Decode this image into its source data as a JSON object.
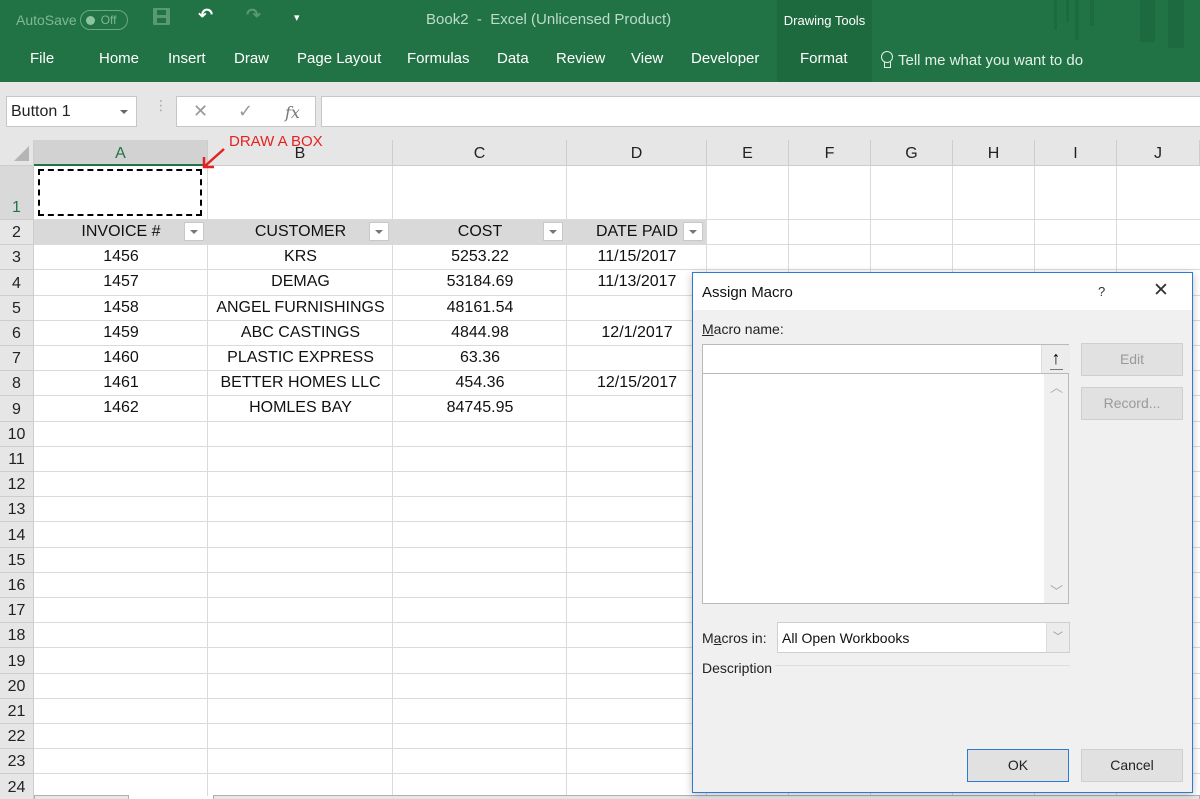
{
  "titlebar": {
    "autosave_label": "AutoSave",
    "autosave_state": "Off",
    "document_title": "Book2  -  Excel (Unlicensed Product)",
    "contextual_group": "Drawing Tools",
    "icons": [
      "save-icon",
      "undo-icon",
      "redo-icon",
      "customize-qat-icon"
    ]
  },
  "ribbon": {
    "tabs": [
      {
        "label": "File"
      },
      {
        "label": "Home"
      },
      {
        "label": "Insert"
      },
      {
        "label": "Draw"
      },
      {
        "label": "Page Layout"
      },
      {
        "label": "Formulas"
      },
      {
        "label": "Data"
      },
      {
        "label": "Review"
      },
      {
        "label": "View"
      },
      {
        "label": "Developer"
      },
      {
        "label": "Format"
      }
    ],
    "tell_me": "Tell me what you want to do"
  },
  "formula_bar": {
    "name_box": "Button 1",
    "cancel_glyph": "✕",
    "enter_glyph": "✓",
    "fx_glyph": "fx",
    "formula": ""
  },
  "sheet": {
    "columns": [
      "A",
      "B",
      "C",
      "D",
      "E",
      "F",
      "G",
      "H",
      "I",
      "J"
    ],
    "selected_column": "A",
    "rows": [
      "1",
      "2",
      "3",
      "4",
      "5",
      "6",
      "7",
      "8",
      "9",
      "10",
      "11",
      "12",
      "13",
      "14",
      "15",
      "16",
      "17",
      "18",
      "19",
      "20",
      "21",
      "22",
      "23",
      "24"
    ],
    "selected_row": "1",
    "annotation": "DRAW A BOX",
    "table_headers": [
      "INVOICE #",
      "CUSTOMER",
      "COST",
      "DATE PAID"
    ],
    "table_rows": [
      [
        "1456",
        "KRS",
        "5253.22",
        "11/15/2017"
      ],
      [
        "1457",
        "DEMAG",
        "53184.69",
        "11/13/2017"
      ],
      [
        "1458",
        "ANGEL FURNISHINGS",
        "48161.54",
        ""
      ],
      [
        "1459",
        "ABC CASTINGS",
        "4844.98",
        "12/1/2017"
      ],
      [
        "1460",
        "PLASTIC EXPRESS",
        "63.36",
        ""
      ],
      [
        "1461",
        "BETTER HOMES LLC",
        "454.36",
        "12/15/2017"
      ],
      [
        "1462",
        "HOMLES BAY",
        "84745.95",
        ""
      ]
    ]
  },
  "dialog": {
    "title": "Assign Macro",
    "help_glyph": "?",
    "close_glyph": "✕",
    "macro_name_label_u": "M",
    "macro_name_label_rest": "acro name:",
    "macro_name_value": "",
    "macro_list": [],
    "collapse_glyph": "↑",
    "edit_button": "Edit",
    "record_button": "Record...",
    "macros_in_label_pre": "M",
    "macros_in_label_u": "a",
    "macros_in_label_rest": "cros in:",
    "macros_in_value": "All Open Workbooks",
    "description_label": "Description",
    "ok_button": "OK",
    "cancel_button": "Cancel"
  },
  "colors": {
    "excel_green": "#217346",
    "annotation_red": "#e52222",
    "dialog_accent": "#2b7bd0"
  }
}
